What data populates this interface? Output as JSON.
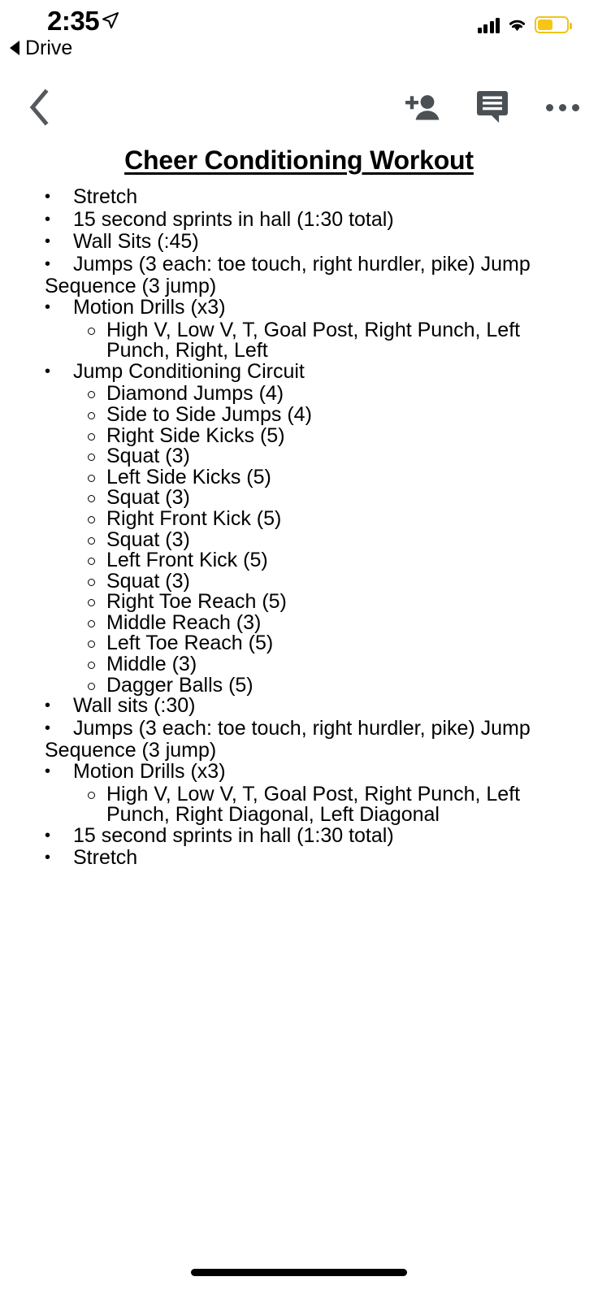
{
  "status_bar": {
    "time": "2:35",
    "location_icon": "location-arrow-icon",
    "signal_icon": "cellular-signal-icon",
    "wifi_icon": "wifi-icon",
    "battery_icon": "battery-icon",
    "battery_level_percent": 52,
    "battery_color": "#f5c518"
  },
  "back_to_app": {
    "label": "Drive",
    "icon": "back-triangle-icon"
  },
  "toolbar": {
    "back_icon": "chevron-left-icon",
    "add_person_icon": "person-add-icon",
    "comment_icon": "comment-bubble-icon",
    "more_icon": "more-horizontal-icon",
    "icon_color": "#4b5055"
  },
  "document": {
    "title": "Cheer Conditioning Workout ",
    "items": [
      {
        "level": 1,
        "text": "Stretch"
      },
      {
        "level": 1,
        "text": "15 second sprints in hall (1:30 total)"
      },
      {
        "level": 1,
        "text": "Wall Sits (:45)"
      },
      {
        "level": 1,
        "text": "Jumps (3 each: toe touch, right hurdler, pike) Jump Sequence (3 jump)"
      },
      {
        "level": 1,
        "text": "Motion Drills (x3)"
      },
      {
        "level": 2,
        "text": "High V, Low V, T, Goal Post, Right Punch, Left Punch, Right, Left"
      },
      {
        "level": 1,
        "text": "Jump Conditioning Circuit"
      },
      {
        "level": 2,
        "text": "Diamond Jumps (4)"
      },
      {
        "level": 2,
        "text": "Side to Side Jumps (4)"
      },
      {
        "level": 2,
        "text": "Right Side Kicks (5)"
      },
      {
        "level": 2,
        "text": "Squat (3)"
      },
      {
        "level": 2,
        "text": "Left Side Kicks (5)"
      },
      {
        "level": 2,
        "text": "Squat (3)"
      },
      {
        "level": 2,
        "text": "Right Front Kick (5)"
      },
      {
        "level": 2,
        "text": "Squat (3)"
      },
      {
        "level": 2,
        "text": "Left Front Kick (5)"
      },
      {
        "level": 2,
        "text": "Squat (3)"
      },
      {
        "level": 2,
        "text": "Right Toe Reach (5)"
      },
      {
        "level": 2,
        "text": "Middle Reach (3)"
      },
      {
        "level": 2,
        "text": "Left Toe Reach (5)"
      },
      {
        "level": 2,
        "text": "Middle (3)"
      },
      {
        "level": 2,
        "text": "Dagger Balls (5)"
      },
      {
        "level": 1,
        "text": "Wall sits (:30)"
      },
      {
        "level": 1,
        "text": "Jumps (3 each: toe touch, right hurdler, pike) Jump Sequence (3 jump)"
      },
      {
        "level": 1,
        "text": "Motion Drills (x3)"
      },
      {
        "level": 2,
        "text": "High V, Low V, T, Goal Post, Right Punch, Left Punch, Right Diagonal, Left Diagonal"
      },
      {
        "level": 1,
        "text": "15 second sprints in hall (1:30 total)"
      },
      {
        "level": 1,
        "text": "Stretch"
      }
    ]
  },
  "home_indicator": {
    "icon": "home-indicator-bar"
  }
}
